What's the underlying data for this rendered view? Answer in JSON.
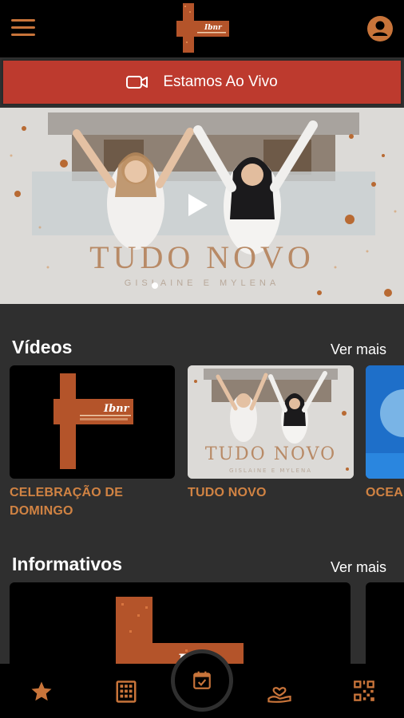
{
  "header": {
    "menu_icon": "hamburger-icon",
    "logo_text": "Ibnr",
    "account_icon": "account-circle-icon"
  },
  "live": {
    "icon": "video-camera-icon",
    "label": "Estamos Ao Vivo"
  },
  "hero": {
    "title": "TUDO NOVO",
    "subtitle": "GISLAINE E MYLENA",
    "play_icon": "play-icon"
  },
  "videos": {
    "title": "Vídeos",
    "see_more": "Ver mais",
    "items": [
      {
        "title": "CELEBRAÇÃO DE DOMINGO"
      },
      {
        "title": "TUDO NOVO",
        "thumb_title": "TUDO NOVO",
        "thumb_subtitle": "GISLAINE E MYLENA"
      },
      {
        "title": "OCEA"
      }
    ]
  },
  "info": {
    "title": "Informativos",
    "see_more": "Ver mais"
  },
  "bottom_nav": [
    "star-icon",
    "calendar-grid-icon",
    "calendar-check-icon",
    "hand-heart-icon",
    "qr-code-icon"
  ],
  "colors": {
    "accent": "#d18343",
    "live": "#bd3a2e",
    "background": "#2f2f2f",
    "bar": "#000000"
  }
}
